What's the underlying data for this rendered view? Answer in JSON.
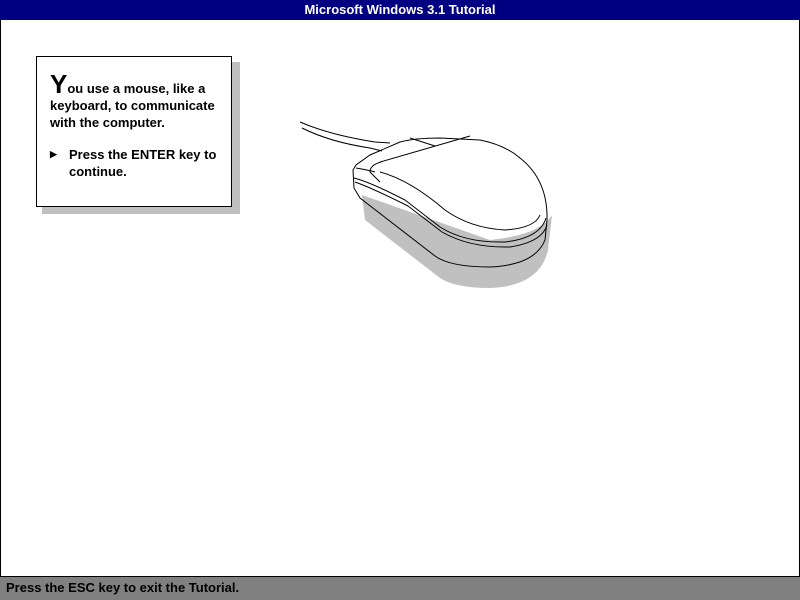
{
  "window": {
    "title": "Microsoft Windows 3.1 Tutorial"
  },
  "card": {
    "dropcap": "Y",
    "intro": "ou use a  mouse, like a keyboard, to communicate with the computer.",
    "instruction": "Press the ENTER key to continue.",
    "bullet_icon": "triangle-right-icon"
  },
  "illustration": {
    "icon": "mouse-illustration"
  },
  "status": {
    "text": "Press the ESC key to exit the Tutorial."
  },
  "colors": {
    "titlebar": "#000080",
    "statusbar": "#808080",
    "shadow": "#c0c0c0"
  }
}
